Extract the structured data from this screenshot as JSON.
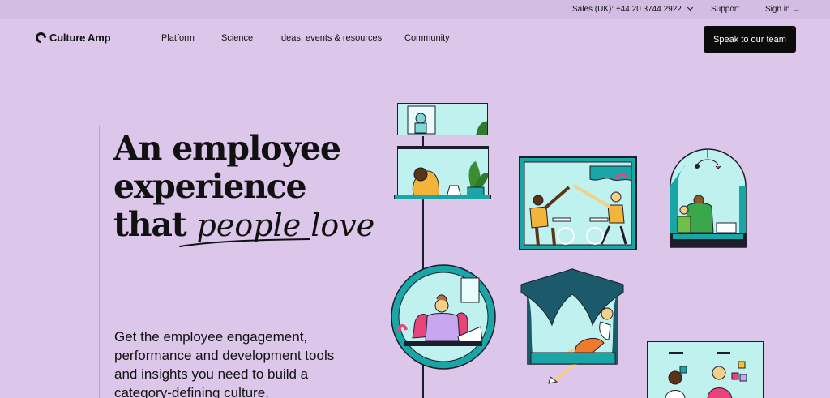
{
  "topbar": {
    "sales": "Sales (UK): +44 20 3744 2922",
    "support": "Support",
    "signin": "Sign in →"
  },
  "nav": {
    "brand": "Culture Amp",
    "links": [
      "Platform",
      "Science",
      "Ideas, events & resources",
      "Community"
    ],
    "cta": "Speak to our team"
  },
  "hero": {
    "line1": "An employee",
    "line2": "experience",
    "line3_lead": "that",
    "line3_script": "people love",
    "sub": "Get the employee engagement, performance and development tools and insights you need to build a category-defining culture."
  },
  "colors": {
    "background": "#dcc6ea",
    "topbar": "#d4bde2",
    "cta": "#0b0b0b",
    "teal": "#1aa6a6",
    "window": "#bff2ef"
  }
}
